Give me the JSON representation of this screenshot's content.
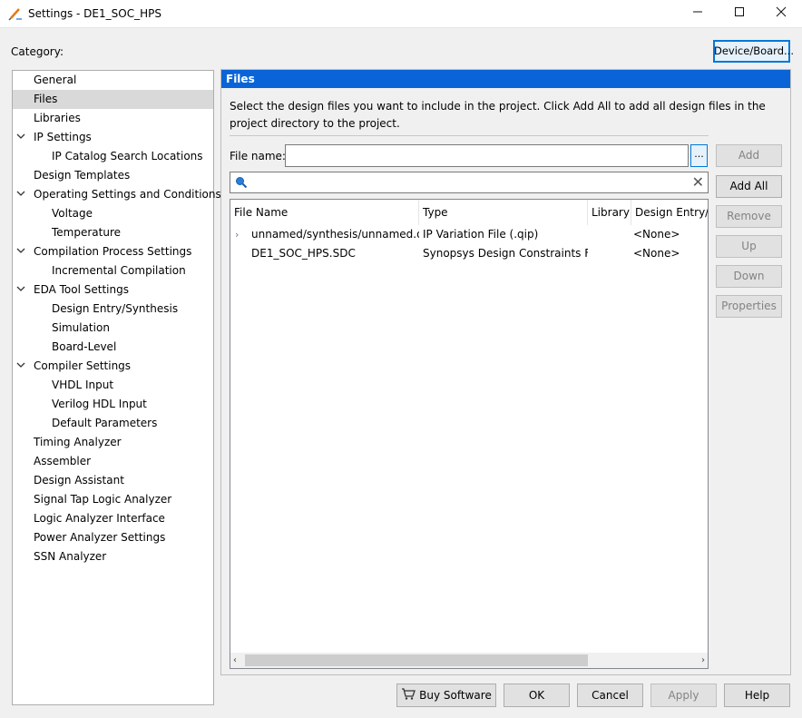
{
  "window": {
    "title": "Settings - DE1_SOC_HPS",
    "minimize": "—",
    "maximize": "☐",
    "close": "✕"
  },
  "category_label": "Category:",
  "device_board_button": "Device/Board...",
  "tree": {
    "items": [
      {
        "label": "General",
        "level": 0
      },
      {
        "label": "Files",
        "level": 0,
        "selected": true
      },
      {
        "label": "Libraries",
        "level": 0
      },
      {
        "label": "IP Settings",
        "level": 0,
        "expanded": true
      },
      {
        "label": "IP Catalog Search Locations",
        "level": 1
      },
      {
        "label": "Design Templates",
        "level": 0
      },
      {
        "label": "Operating Settings and Conditions",
        "level": 0,
        "expanded": true
      },
      {
        "label": "Voltage",
        "level": 1
      },
      {
        "label": "Temperature",
        "level": 1
      },
      {
        "label": "Compilation Process Settings",
        "level": 0,
        "expanded": true
      },
      {
        "label": "Incremental Compilation",
        "level": 1
      },
      {
        "label": "EDA Tool Settings",
        "level": 0,
        "expanded": true
      },
      {
        "label": "Design Entry/Synthesis",
        "level": 1
      },
      {
        "label": "Simulation",
        "level": 1
      },
      {
        "label": "Board-Level",
        "level": 1
      },
      {
        "label": "Compiler Settings",
        "level": 0,
        "expanded": true
      },
      {
        "label": "VHDL Input",
        "level": 1
      },
      {
        "label": "Verilog HDL Input",
        "level": 1
      },
      {
        "label": "Default Parameters",
        "level": 1
      },
      {
        "label": "Timing Analyzer",
        "level": 0
      },
      {
        "label": "Assembler",
        "level": 0
      },
      {
        "label": "Design Assistant",
        "level": 0
      },
      {
        "label": "Signal Tap Logic Analyzer",
        "level": 0
      },
      {
        "label": "Logic Analyzer Interface",
        "level": 0
      },
      {
        "label": "Power Analyzer Settings",
        "level": 0
      },
      {
        "label": "SSN Analyzer",
        "level": 0
      }
    ]
  },
  "files": {
    "header": "Files",
    "description": "Select the design files you want to include in the project. Click Add All to add all design files in the project directory to the project.",
    "file_name_label": "File name:",
    "file_name_value": "",
    "browse_label": "...",
    "search_value": "",
    "columns": [
      "File Name",
      "Type",
      "Library",
      "Design Entry/S"
    ],
    "rows": [
      {
        "file_name": "unnamed/synthesis/unnamed.qip",
        "type": "IP Variation File (.qip)",
        "library": "",
        "design_entry": "<None>",
        "expandable": true
      },
      {
        "file_name": "DE1_SOC_HPS.SDC",
        "type": "Synopsys Design Constraints File",
        "library": "",
        "design_entry": "<None>",
        "expandable": false
      }
    ],
    "buttons": {
      "add": "Add",
      "add_all": "Add All",
      "remove": "Remove",
      "up": "Up",
      "down": "Down",
      "properties": "Properties"
    }
  },
  "footer": {
    "buy_software": "Buy Software",
    "ok": "OK",
    "cancel": "Cancel",
    "apply": "Apply",
    "help": "Help"
  }
}
